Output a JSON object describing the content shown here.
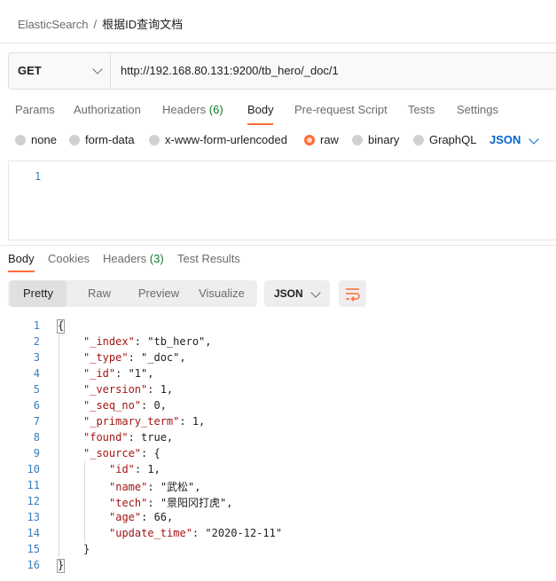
{
  "breadcrumb": {
    "collection": "ElasticSearch",
    "separator": "/",
    "request": "根据ID查询文档"
  },
  "request": {
    "method": "GET",
    "url": "http://192.168.80.131:9200/tb_hero/_doc/1"
  },
  "request_tabs": [
    {
      "label": "Params"
    },
    {
      "label": "Authorization"
    },
    {
      "label": "Headers",
      "count": "(6)"
    },
    {
      "label": "Body",
      "active": true
    },
    {
      "label": "Pre-request Script"
    },
    {
      "label": "Tests"
    },
    {
      "label": "Settings"
    }
  ],
  "body_types": [
    {
      "label": "none"
    },
    {
      "label": "form-data"
    },
    {
      "label": "x-www-form-urlencoded"
    },
    {
      "label": "raw",
      "selected": true
    },
    {
      "label": "binary"
    },
    {
      "label": "GraphQL"
    }
  ],
  "body_format": "JSON",
  "request_editor": {
    "line_numbers": [
      "1"
    ]
  },
  "response_tabs": [
    {
      "label": "Body",
      "active": true
    },
    {
      "label": "Cookies"
    },
    {
      "label": "Headers",
      "count": "(3)"
    },
    {
      "label": "Test Results"
    }
  ],
  "view_modes": [
    {
      "label": "Pretty",
      "active": true
    },
    {
      "label": "Raw"
    },
    {
      "label": "Preview"
    },
    {
      "label": "Visualize"
    }
  ],
  "response_format": "JSON",
  "response_lines": [
    {
      "n": "1",
      "text": "{"
    },
    {
      "n": "2",
      "text": "\"_index\": \"tb_hero\","
    },
    {
      "n": "3",
      "text": "\"_type\": \"_doc\","
    },
    {
      "n": "4",
      "text": "\"_id\": \"1\","
    },
    {
      "n": "5",
      "text": "\"_version\": 1,"
    },
    {
      "n": "6",
      "text": "\"_seq_no\": 0,"
    },
    {
      "n": "7",
      "text": "\"_primary_term\": 1,"
    },
    {
      "n": "8",
      "text": "\"found\": true,"
    },
    {
      "n": "9",
      "text": "\"_source\": {"
    },
    {
      "n": "10",
      "text": "\"id\": 1,"
    },
    {
      "n": "11",
      "text": "\"name\": \"武松\","
    },
    {
      "n": "12",
      "text": "\"tech\": \"景阳冈打虎\","
    },
    {
      "n": "13",
      "text": "\"age\": 66,"
    },
    {
      "n": "14",
      "text": "\"update_time\": \"2020-12-11\""
    },
    {
      "n": "15",
      "text": "}"
    },
    {
      "n": "16",
      "text": "}"
    }
  ],
  "colors": {
    "accent": "#ff6c37",
    "link_blue": "#0265d2",
    "count_green": "#0c7b2c",
    "json_key": "#a31515",
    "json_string": "#0451a5",
    "json_number": "#098658"
  }
}
